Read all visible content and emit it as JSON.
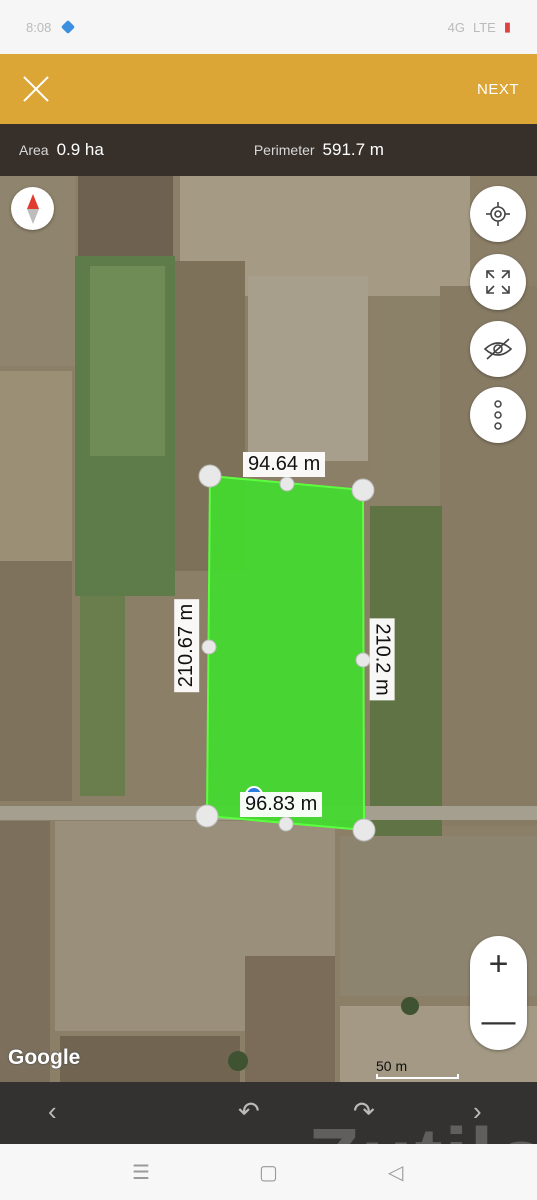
{
  "status_bar": {
    "time": "8:08",
    "signal": "4G",
    "network": "LTE"
  },
  "top_bar": {
    "next_label": "NEXT"
  },
  "info": {
    "area_label": "Area",
    "area_value": "0.9 ha",
    "perimeter_label": "Perimeter",
    "perimeter_value": "591.7 m"
  },
  "map": {
    "edges": {
      "top": "94.64 m",
      "left": "210.67 m",
      "right": "210.2 m",
      "bottom": "96.83 m"
    },
    "attribution": "Google",
    "scale_label": "50 m",
    "polygon_color": "#44d92f"
  },
  "controls": {
    "locate_icon": "crosshair-icon",
    "fullscreen_icon": "expand-icon",
    "visibility_icon": "eye-off-icon",
    "more_icon": "more-vertical-icon",
    "zoom_in": "+",
    "zoom_out": "—"
  },
  "bottom_bar": {
    "back_icon": "chevron-left-icon",
    "undo_icon": "undo-icon",
    "redo_icon": "redo-icon",
    "forward_icon": "chevron-right-icon"
  },
  "watermark": "Zutilo"
}
